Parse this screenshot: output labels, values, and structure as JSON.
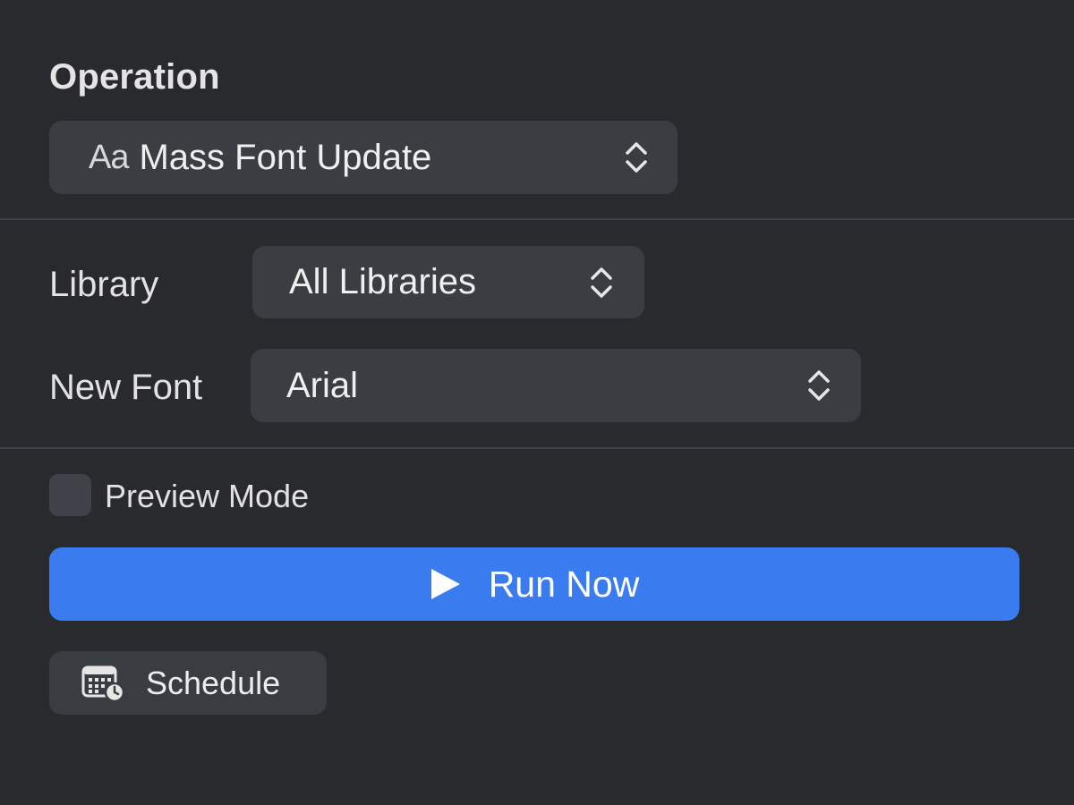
{
  "operation": {
    "title": "Operation",
    "icon_text": "Aa",
    "selected": "Mass Font Update"
  },
  "library": {
    "label": "Library",
    "selected": "All Libraries"
  },
  "new_font": {
    "label": "New Font",
    "selected": "Arial"
  },
  "preview": {
    "label": "Preview Mode",
    "checked": false
  },
  "run": {
    "label": "Run Now",
    "icon": "play-icon"
  },
  "schedule": {
    "label": "Schedule",
    "icon": "calendar-clock-icon"
  },
  "colors": {
    "background": "#282a2e",
    "control": "#3a3d42",
    "accent": "#3a7bf0"
  }
}
